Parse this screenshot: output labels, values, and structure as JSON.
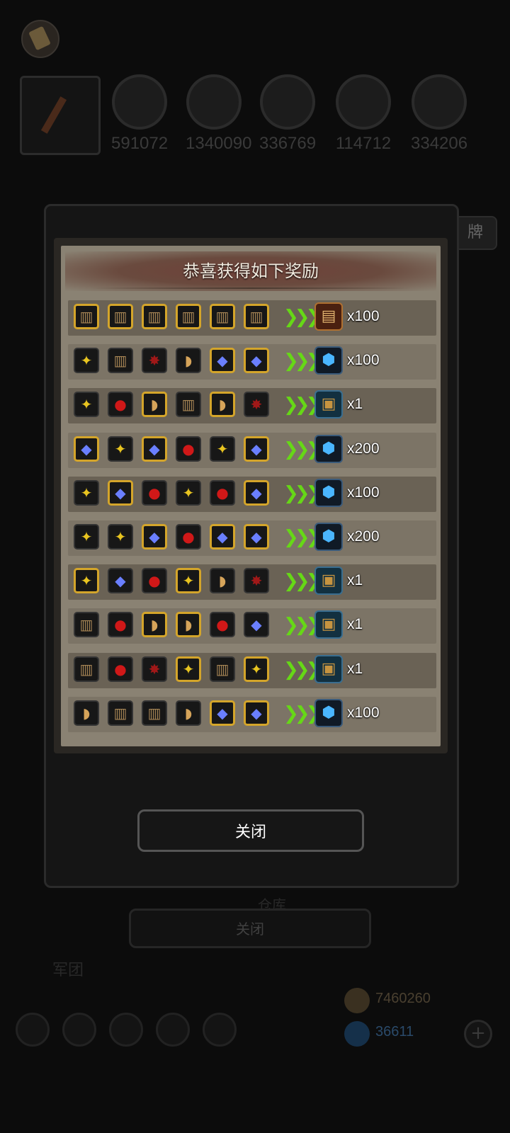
{
  "dialog": {
    "title": "恭喜获得如下奖励",
    "close_label": "关闭"
  },
  "background": {
    "top_icon": "scroll-icon",
    "resources": [
      "591072",
      "1340090",
      "336769",
      "114712",
      "334206"
    ],
    "side_tab_label": "牌",
    "under_dialog_label": "仓库",
    "ghost_close_label": "关闭",
    "group_label": "军团",
    "gold": "7460260",
    "diamonds": "36611"
  },
  "rewards": [
    {
      "ingredients": [
        {
          "icon": "barrel",
          "gold": true
        },
        {
          "icon": "barrel",
          "gold": true
        },
        {
          "icon": "barrel",
          "gold": true
        },
        {
          "icon": "barrel",
          "gold": true
        },
        {
          "icon": "barrel",
          "gold": true
        },
        {
          "icon": "barrel",
          "gold": true
        }
      ],
      "result": "scroll",
      "qty": "x100"
    },
    {
      "ingredients": [
        {
          "icon": "ore",
          "gold": false
        },
        {
          "icon": "barrel",
          "gold": false
        },
        {
          "icon": "ruby",
          "gold": false
        },
        {
          "icon": "bread",
          "gold": false
        },
        {
          "icon": "gem",
          "gold": true
        },
        {
          "icon": "gem",
          "gold": true
        }
      ],
      "result": "crystal",
      "qty": "x100"
    },
    {
      "ingredients": [
        {
          "icon": "ore",
          "gold": false
        },
        {
          "icon": "blood",
          "gold": false
        },
        {
          "icon": "bread",
          "gold": true
        },
        {
          "icon": "barrel",
          "gold": false
        },
        {
          "icon": "bread",
          "gold": true
        },
        {
          "icon": "ruby",
          "gold": false
        }
      ],
      "result": "chest",
      "qty": "x1"
    },
    {
      "ingredients": [
        {
          "icon": "gem",
          "gold": true
        },
        {
          "icon": "ore",
          "gold": false
        },
        {
          "icon": "gem",
          "gold": true
        },
        {
          "icon": "blood",
          "gold": false
        },
        {
          "icon": "ore",
          "gold": false
        },
        {
          "icon": "gem",
          "gold": true
        }
      ],
      "result": "crystal",
      "qty": "x200"
    },
    {
      "ingredients": [
        {
          "icon": "ore",
          "gold": false
        },
        {
          "icon": "gem",
          "gold": true
        },
        {
          "icon": "blood",
          "gold": false
        },
        {
          "icon": "ore",
          "gold": false
        },
        {
          "icon": "blood",
          "gold": false
        },
        {
          "icon": "gem",
          "gold": true
        }
      ],
      "result": "crystal",
      "qty": "x100"
    },
    {
      "ingredients": [
        {
          "icon": "ore",
          "gold": false
        },
        {
          "icon": "ore",
          "gold": false
        },
        {
          "icon": "gem",
          "gold": true
        },
        {
          "icon": "blood",
          "gold": false
        },
        {
          "icon": "gem",
          "gold": true
        },
        {
          "icon": "gem",
          "gold": true
        }
      ],
      "result": "crystal",
      "qty": "x200"
    },
    {
      "ingredients": [
        {
          "icon": "ore",
          "gold": true
        },
        {
          "icon": "gem",
          "gold": false
        },
        {
          "icon": "blood",
          "gold": false
        },
        {
          "icon": "ore",
          "gold": true
        },
        {
          "icon": "bread",
          "gold": false
        },
        {
          "icon": "ruby",
          "gold": false
        }
      ],
      "result": "chest",
      "qty": "x1"
    },
    {
      "ingredients": [
        {
          "icon": "barrel",
          "gold": false
        },
        {
          "icon": "blood",
          "gold": false
        },
        {
          "icon": "bread",
          "gold": true
        },
        {
          "icon": "bread",
          "gold": true
        },
        {
          "icon": "blood",
          "gold": false
        },
        {
          "icon": "gem",
          "gold": false
        }
      ],
      "result": "chest",
      "qty": "x1"
    },
    {
      "ingredients": [
        {
          "icon": "barrel",
          "gold": false
        },
        {
          "icon": "blood",
          "gold": false
        },
        {
          "icon": "ruby",
          "gold": false
        },
        {
          "icon": "ore",
          "gold": true
        },
        {
          "icon": "barrel",
          "gold": false
        },
        {
          "icon": "ore",
          "gold": true
        }
      ],
      "result": "chest",
      "qty": "x1"
    },
    {
      "ingredients": [
        {
          "icon": "bread",
          "gold": false
        },
        {
          "icon": "barrel",
          "gold": false
        },
        {
          "icon": "barrel",
          "gold": false
        },
        {
          "icon": "bread",
          "gold": false
        },
        {
          "icon": "gem",
          "gold": true
        },
        {
          "icon": "gem",
          "gold": true
        }
      ],
      "result": "crystal",
      "qty": "x100"
    }
  ],
  "icon_glyphs": {
    "barrel": "▥",
    "gem": "◆",
    "blood": "●",
    "ruby": "✸",
    "ore": "✦",
    "bread": "◗",
    "crystal": "⬢",
    "chest": "▣",
    "scroll": "▤"
  },
  "colors": {
    "slot_gold_border": "#d4a52a",
    "arrow": "#66d816",
    "title_bar": "#6e4038"
  }
}
